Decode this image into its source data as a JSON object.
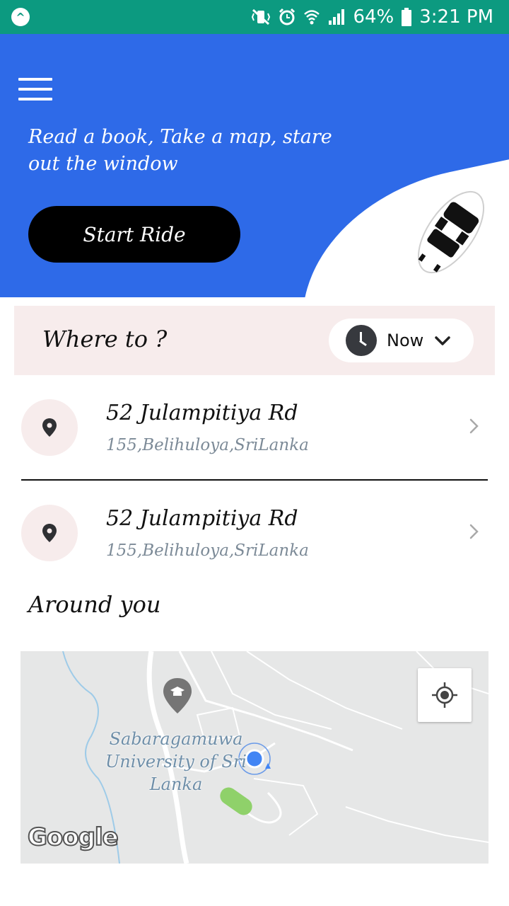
{
  "status_bar": {
    "battery": "64%",
    "time": "3:21 PM"
  },
  "header": {
    "tagline": "Read a book, Take a map, stare out the window",
    "start_button": "Start Ride"
  },
  "where_to": {
    "label": "Where to ?",
    "time_option": "Now"
  },
  "recent_locations": [
    {
      "title": "52 Julampitiya Rd",
      "subtitle": "155,Belihuloya,SriLanka"
    },
    {
      "title": "52 Julampitiya Rd",
      "subtitle": "155,Belihuloya,SriLanka"
    }
  ],
  "around": {
    "heading": "Around you",
    "map_place_label": "Sabaragamuwa University of Sri Lanka",
    "map_logo": "Google"
  },
  "colors": {
    "status_bar": "#0c9a80",
    "header_bg": "#2e6ae8",
    "where_bg": "#f7ecec"
  }
}
